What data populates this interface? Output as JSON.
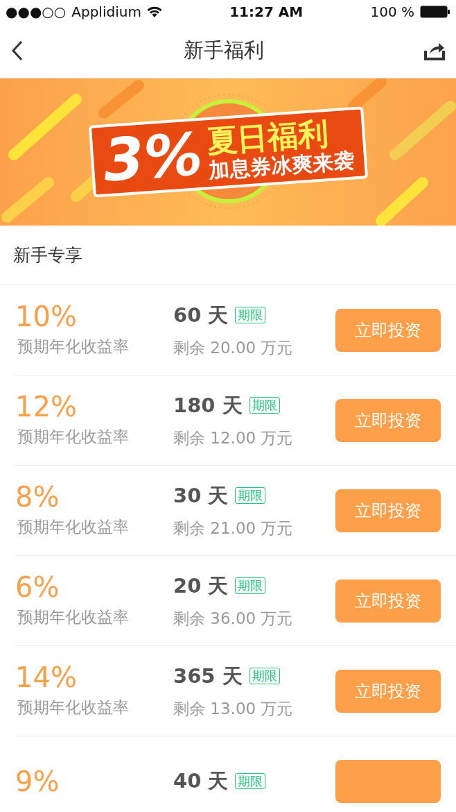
{
  "status_bar": {
    "signal": "●●●○○",
    "carrier": "Applidium",
    "time": "11:27 AM",
    "battery": "100 %"
  },
  "nav": {
    "title": "新手福利"
  },
  "banner": {
    "kind": "picture",
    "rate": "3%",
    "headline": "夏日福利",
    "subline": "加息券冰爽来袭"
  },
  "section": {
    "title": "新手专享"
  },
  "products": [
    {
      "rate": "10%",
      "rate_label": "预期年化收益率",
      "term": "60 天",
      "tag": "期限",
      "remaining": "剩余 20.00 万元",
      "button": "立即投资"
    },
    {
      "rate": "12%",
      "rate_label": "预期年化收益率",
      "term": "180 天",
      "tag": "期限",
      "remaining": "剩余 12.00 万元",
      "button": "立即投资"
    },
    {
      "rate": "8%",
      "rate_label": "预期年化收益率",
      "term": "30 天",
      "tag": "期限",
      "remaining": "剩余 21.00 万元",
      "button": "立即投资"
    },
    {
      "rate": "6%",
      "rate_label": "预期年化收益率",
      "term": "20 天",
      "tag": "期限",
      "remaining": "剩余 36.00 万元",
      "button": "立即投资"
    },
    {
      "rate": "14%",
      "rate_label": "预期年化收益率",
      "term": "365 天",
      "tag": "期限",
      "remaining": "剩余 13.00 万元",
      "button": "立即投资"
    },
    {
      "rate": "9%",
      "term": "40 天",
      "tag": "期限"
    }
  ]
}
